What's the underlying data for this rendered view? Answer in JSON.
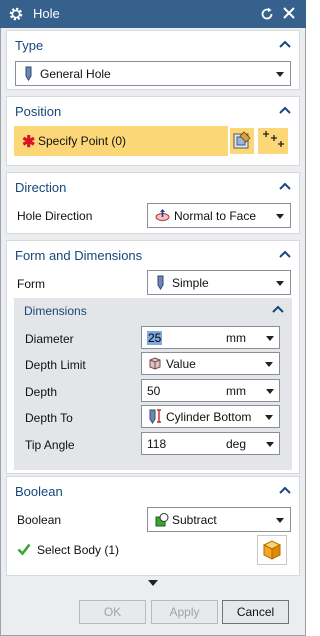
{
  "window": {
    "title": "Hole"
  },
  "type_section": {
    "title": "Type",
    "selected": "General Hole"
  },
  "position_section": {
    "title": "Position",
    "specify_point": "Specify Point (0)"
  },
  "direction_section": {
    "title": "Direction",
    "hole_direction_label": "Hole Direction",
    "hole_direction_value": "Normal to Face"
  },
  "form_section": {
    "title": "Form and Dimensions",
    "form_label": "Form",
    "form_value": "Simple",
    "dimensions": {
      "title": "Dimensions",
      "diameter_label": "Diameter",
      "diameter_value": "25",
      "diameter_unit": "mm",
      "depth_limit_label": "Depth Limit",
      "depth_limit_value": "Value",
      "depth_label": "Depth",
      "depth_value": "50",
      "depth_unit": "mm",
      "depth_to_label": "Depth To",
      "depth_to_value": "Cylinder Bottom",
      "tip_angle_label": "Tip Angle",
      "tip_angle_value": "118",
      "tip_angle_unit": "deg"
    }
  },
  "boolean_section": {
    "title": "Boolean",
    "boolean_label": "Boolean",
    "boolean_value": "Subtract",
    "select_body": "Select Body (1)"
  },
  "buttons": {
    "ok": "OK",
    "apply": "Apply",
    "cancel": "Cancel"
  },
  "colors": {
    "titlebar": "#36618c",
    "section_title": "#17477a",
    "highlight": "#fbd777",
    "required": "#d7142a",
    "check": "#3aa531"
  }
}
